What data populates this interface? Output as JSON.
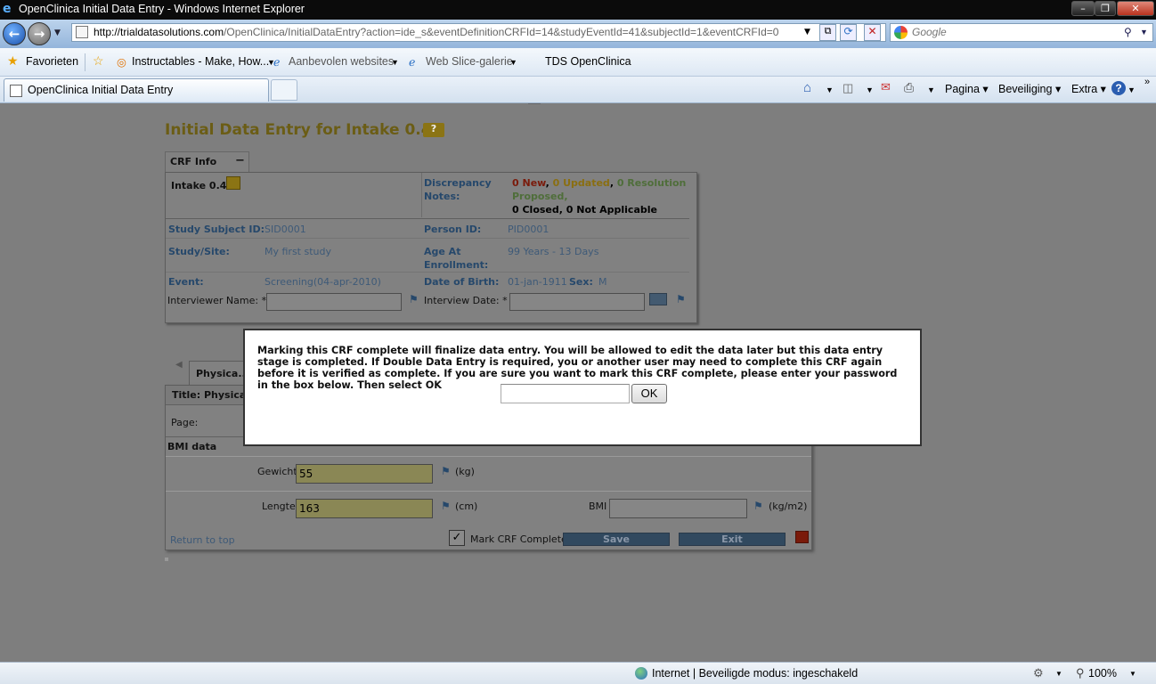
{
  "window": {
    "title": "OpenClinica Initial Data Entry - Windows Internet Explorer"
  },
  "nav": {
    "url_host": "http://trialdatasolutions.com",
    "url_path": "/OpenClinica/InitialDataEntry?action=ide_s&eventDefinitionCRFId=14&studyEventId=41&subjectId=1&eventCRFId=0",
    "search_placeholder": "Google"
  },
  "favorites": {
    "label": "Favorieten",
    "items": [
      "Instructables - Make, How...",
      "Aanbevolen websites",
      "Web Slice-galerie",
      "TDS OpenClinica"
    ]
  },
  "tabs": {
    "active": "OpenClinica Initial Data Entry"
  },
  "commandbar": {
    "page": "Pagina",
    "security": "Beveiliging",
    "extra": "Extra"
  },
  "page": {
    "title": "Initial Data Entry for Intake 0.4",
    "help": "?"
  },
  "crf_info": {
    "tab_label": "CRF Info",
    "collapse": "−",
    "crf_name": "Intake 0.4",
    "discrepancy_label_1": "Discrepancy",
    "discrepancy_label_2": "Notes:",
    "disc_new": "0 New",
    "disc_updated": "0 Updated",
    "disc_resolution_1": "0 Resolution",
    "disc_resolution_2": "Proposed",
    "disc_closed": "0 Closed",
    "disc_na": "0 Not Applicable",
    "subject_id_label": "Study Subject ID:",
    "subject_id": "SID0001",
    "person_id_label": "Person ID:",
    "person_id": "PID0001",
    "study_site_label": "Study/Site:",
    "study_site": "My first study",
    "age_label_1": "Age At",
    "age_label_2": "Enrollment:",
    "age": "99 Years - 13 Days",
    "event_label": "Event:",
    "event": "Screening(04-apr-2010)",
    "dob_label": "Date of Birth:",
    "dob": "01-jan-1911",
    "sex_label": "Sex:",
    "sex": "M",
    "interviewer_label": "Interviewer Name: *",
    "interview_date_label": "Interview Date: *"
  },
  "section": {
    "tab_label": "Physica...",
    "title_label": "Title: Physical",
    "page_label": "Page:",
    "group_label": "BMI data",
    "weight_label": "Gewicht",
    "weight_value": "55",
    "weight_unit": "(kg)",
    "length_label": "Lengte",
    "length_value": "163",
    "length_unit": "(cm)",
    "bmi_label": "BMI",
    "bmi_unit": "(kg/m2)",
    "return_top": "Return to top",
    "mark_complete": "Mark CRF Complete",
    "save": "Save",
    "exit": "Exit"
  },
  "dialog": {
    "message": "Marking this CRF complete will finalize data entry. You will be allowed to edit the data later but this data entry stage is completed. If Double Data Entry is required, you or another user may need to complete this CRF again before it is verified as complete. If you are sure you want to mark this CRF complete, please enter your password in the box below. Then select OK",
    "ok": "OK"
  },
  "status": {
    "zone": "Internet | Beveiligde modus: ingeschakeld",
    "zoom": "100%"
  },
  "colors": {
    "disc_new": "#7a1a0a",
    "disc_updated": "#8a6e10",
    "disc_resolution": "#4f6e3a",
    "title": "#6b5d15"
  }
}
